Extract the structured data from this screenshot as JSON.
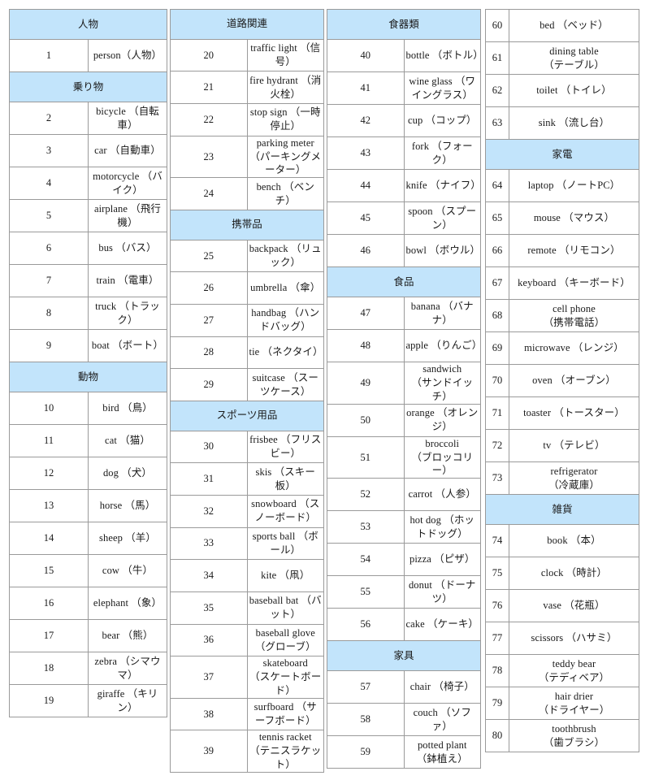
{
  "document": {
    "title": "COCO 80 object classes (English / Japanese)",
    "header_bg_color": "#c2e4fb",
    "border_color": "#9a9a9a",
    "text_color": "#1a1a1a"
  },
  "columns": [
    {
      "id": "column-1",
      "rows": [
        {
          "type": "group",
          "label": "人物"
        },
        {
          "type": "item",
          "num": "1",
          "line1": "person（人物）"
        },
        {
          "type": "group",
          "label": "乗り物"
        },
        {
          "type": "item",
          "num": "2",
          "line1": "bicycle （自転車）"
        },
        {
          "type": "item",
          "num": "3",
          "line1": "car （自動車）"
        },
        {
          "type": "item",
          "num": "4",
          "line1": "motorcycle （バイク）"
        },
        {
          "type": "item",
          "num": "5",
          "line1": "airplane （飛行機）"
        },
        {
          "type": "item",
          "num": "6",
          "line1": "bus （バス）"
        },
        {
          "type": "item",
          "num": "7",
          "line1": "train （電車）"
        },
        {
          "type": "item",
          "num": "8",
          "line1": "truck （トラック）"
        },
        {
          "type": "item",
          "num": "9",
          "line1": "boat （ボート）"
        },
        {
          "type": "group",
          "label": "動物"
        },
        {
          "type": "item",
          "num": "10",
          "line1": "bird （鳥）"
        },
        {
          "type": "item",
          "num": "11",
          "line1": "cat （猫）"
        },
        {
          "type": "item",
          "num": "12",
          "line1": "dog （犬）"
        },
        {
          "type": "item",
          "num": "13",
          "line1": "horse （馬）"
        },
        {
          "type": "item",
          "num": "14",
          "line1": "sheep （羊）"
        },
        {
          "type": "item",
          "num": "15",
          "line1": "cow （牛）"
        },
        {
          "type": "item",
          "num": "16",
          "line1": "elephant （象）"
        },
        {
          "type": "item",
          "num": "17",
          "line1": "bear （熊）"
        },
        {
          "type": "item",
          "num": "18",
          "line1": "zebra （シマウマ）"
        },
        {
          "type": "item",
          "num": "19",
          "line1": "giraffe （キリン）"
        }
      ]
    },
    {
      "id": "column-2",
      "rows": [
        {
          "type": "group",
          "label": "道路関連"
        },
        {
          "type": "item",
          "num": "20",
          "line1": "traffic light （信号）"
        },
        {
          "type": "item",
          "num": "21",
          "line1": "fire hydrant （消火栓）"
        },
        {
          "type": "item",
          "num": "22",
          "line1": "stop sign （一時停止）"
        },
        {
          "type": "item",
          "num": "23",
          "line1": "parking meter",
          "line2": "（パーキングメーター）"
        },
        {
          "type": "item",
          "num": "24",
          "line1": "bench （ベンチ）"
        },
        {
          "type": "group",
          "label": "携帯品"
        },
        {
          "type": "item",
          "num": "25",
          "line1": "backpack （リュック）"
        },
        {
          "type": "item",
          "num": "26",
          "line1": "umbrella （傘）"
        },
        {
          "type": "item",
          "num": "27",
          "line1": "handbag （ハンドバッグ）"
        },
        {
          "type": "item",
          "num": "28",
          "line1": "tie （ネクタイ）"
        },
        {
          "type": "item",
          "num": "29",
          "line1": "suitcase （スーツケース）"
        },
        {
          "type": "group",
          "label": "スポーツ用品"
        },
        {
          "type": "item",
          "num": "30",
          "line1": "frisbee （フリスビー）"
        },
        {
          "type": "item",
          "num": "31",
          "line1": "skis （スキー板）"
        },
        {
          "type": "item",
          "num": "32",
          "line1": "snowboard （スノーボード）"
        },
        {
          "type": "item",
          "num": "33",
          "line1": "sports ball （ボール）"
        },
        {
          "type": "item",
          "num": "34",
          "line1": "kite （凧）"
        },
        {
          "type": "item",
          "num": "35",
          "line1": "baseball bat （バット）"
        },
        {
          "type": "item",
          "num": "36",
          "line1": "baseball glove （グローブ）"
        },
        {
          "type": "item",
          "num": "37",
          "line1": "skateboard",
          "line2": "（スケートボード）"
        },
        {
          "type": "item",
          "num": "38",
          "line1": "surfboard （サーフボード）"
        },
        {
          "type": "item",
          "num": "39",
          "line1": "tennis racket",
          "line2": "（テニスラケット）"
        }
      ]
    },
    {
      "id": "column-3",
      "rows": [
        {
          "type": "group",
          "label": "食器類"
        },
        {
          "type": "item",
          "num": "40",
          "line1": "bottle （ボトル）"
        },
        {
          "type": "item",
          "num": "41",
          "line1": "wine glass （ワイングラス）"
        },
        {
          "type": "item",
          "num": "42",
          "line1": "cup （コップ）"
        },
        {
          "type": "item",
          "num": "43",
          "line1": "fork （フォーク）"
        },
        {
          "type": "item",
          "num": "44",
          "line1": "knife （ナイフ）"
        },
        {
          "type": "item",
          "num": "45",
          "line1": "spoon （スプーン）"
        },
        {
          "type": "item",
          "num": "46",
          "line1": "bowl （ボウル）"
        },
        {
          "type": "group",
          "label": "食品"
        },
        {
          "type": "item",
          "num": "47",
          "line1": "banana （バナナ）"
        },
        {
          "type": "item",
          "num": "48",
          "line1": "apple （りんご）"
        },
        {
          "type": "item",
          "num": "49",
          "line1": "sandwich",
          "line2": "（サンドイッチ）"
        },
        {
          "type": "item",
          "num": "50",
          "line1": "orange （オレンジ）"
        },
        {
          "type": "item",
          "num": "51",
          "line1": "broccoli",
          "line2": "（ブロッコリー）"
        },
        {
          "type": "item",
          "num": "52",
          "line1": "carrot （人参）"
        },
        {
          "type": "item",
          "num": "53",
          "line1": "hot dog （ホットドッグ）"
        },
        {
          "type": "item",
          "num": "54",
          "line1": "pizza （ピザ）"
        },
        {
          "type": "item",
          "num": "55",
          "line1": "donut （ドーナツ）"
        },
        {
          "type": "item",
          "num": "56",
          "line1": "cake （ケーキ）"
        },
        {
          "type": "group",
          "label": "家具"
        },
        {
          "type": "item",
          "num": "57",
          "line1": "chair （椅子）"
        },
        {
          "type": "item",
          "num": "58",
          "line1": "couch （ソファ）"
        },
        {
          "type": "item",
          "num": "59",
          "line1": "potted plant",
          "line2": "（鉢植え）"
        }
      ]
    },
    {
      "id": "column-4",
      "rows": [
        {
          "type": "item",
          "num": "60",
          "line1": "bed （ベッド）"
        },
        {
          "type": "item",
          "num": "61",
          "line1": "dining table",
          "line2": "（テーブル）"
        },
        {
          "type": "item",
          "num": "62",
          "line1": "toilet （トイレ）"
        },
        {
          "type": "item",
          "num": "63",
          "line1": "sink （流し台）"
        },
        {
          "type": "group",
          "label": "家電"
        },
        {
          "type": "item",
          "num": "64",
          "line1": "laptop （ノートPC）"
        },
        {
          "type": "item",
          "num": "65",
          "line1": "mouse （マウス）"
        },
        {
          "type": "item",
          "num": "66",
          "line1": "remote （リモコン）"
        },
        {
          "type": "item",
          "num": "67",
          "line1": "keyboard （キーボード）"
        },
        {
          "type": "item",
          "num": "68",
          "line1": "cell phone",
          "line2": "（携帯電話）"
        },
        {
          "type": "item",
          "num": "69",
          "line1": "microwave （レンジ）"
        },
        {
          "type": "item",
          "num": "70",
          "line1": "oven （オーブン）"
        },
        {
          "type": "item",
          "num": "71",
          "line1": "toaster （トースター）"
        },
        {
          "type": "item",
          "num": "72",
          "line1": "tv （テレビ）"
        },
        {
          "type": "item",
          "num": "73",
          "line1": "refrigerator",
          "line2": "（冷蔵庫）"
        },
        {
          "type": "group",
          "label": "雑貨"
        },
        {
          "type": "item",
          "num": "74",
          "line1": "book （本）"
        },
        {
          "type": "item",
          "num": "75",
          "line1": "clock （時計）"
        },
        {
          "type": "item",
          "num": "76",
          "line1": "vase （花瓶）"
        },
        {
          "type": "item",
          "num": "77",
          "line1": "scissors （ハサミ）"
        },
        {
          "type": "item",
          "num": "78",
          "line1": "teddy bear",
          "line2": "（テディベア）"
        },
        {
          "type": "item",
          "num": "79",
          "line1": "hair drier",
          "line2": "（ドライヤー）"
        },
        {
          "type": "item",
          "num": "80",
          "line1": "toothbrush",
          "line2": "（歯ブラシ）"
        }
      ]
    }
  ]
}
